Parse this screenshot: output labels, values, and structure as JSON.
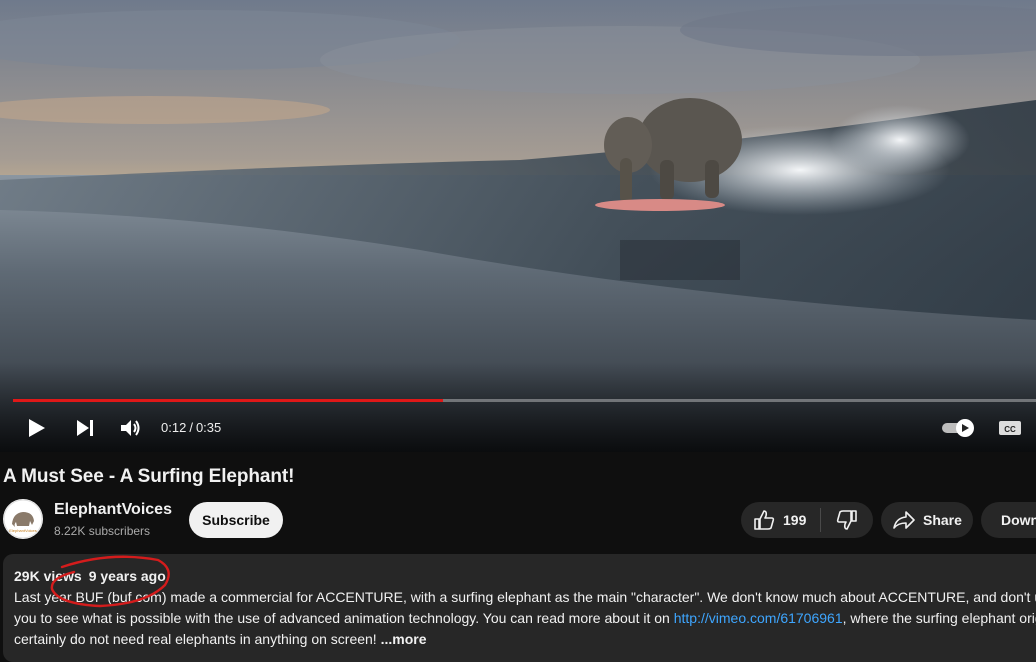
{
  "player": {
    "current_time": "0:12",
    "separator": "/",
    "duration": "0:35",
    "progress_fraction": 0.42,
    "autoplay_on": true,
    "accent": "#e01818"
  },
  "video": {
    "title": "A Must See - A Surfing Elephant!"
  },
  "channel": {
    "name": "ElephantVoices",
    "subscribers": "8.22K subscribers",
    "subscribe_label": "Subscribe",
    "avatar_text": "ElephantVoices"
  },
  "actions": {
    "likes": "199",
    "share_label": "Share",
    "download_label": "Download"
  },
  "description": {
    "views": "29K views",
    "age": "9 years ago",
    "line1": "Last year BUF (buf.com) made a commercial for ACCENTURE, with a surfing elephant as the main \"character\". We don't know much about ACCENTURE, and don't usually",
    "line2_pre": "you to see what is possible with the use of advanced animation technology. You can read more about it on ",
    "link": "http://vimeo.com/61706961",
    "line2_post": ", where the surfing elephant origin",
    "line3": "certainly do not need real elephants in anything on screen! ",
    "more_label": "...more"
  },
  "icons": {
    "play": "play-icon",
    "next": "skip-next-icon",
    "volume": "volume-icon",
    "autoplay": "autoplay-toggle-icon",
    "captions": "cc-icon",
    "like": "thumbs-up-icon",
    "dislike": "thumbs-down-icon",
    "share": "share-arrow-icon",
    "download": "download-icon"
  },
  "annotation_color": "#d41c1c"
}
